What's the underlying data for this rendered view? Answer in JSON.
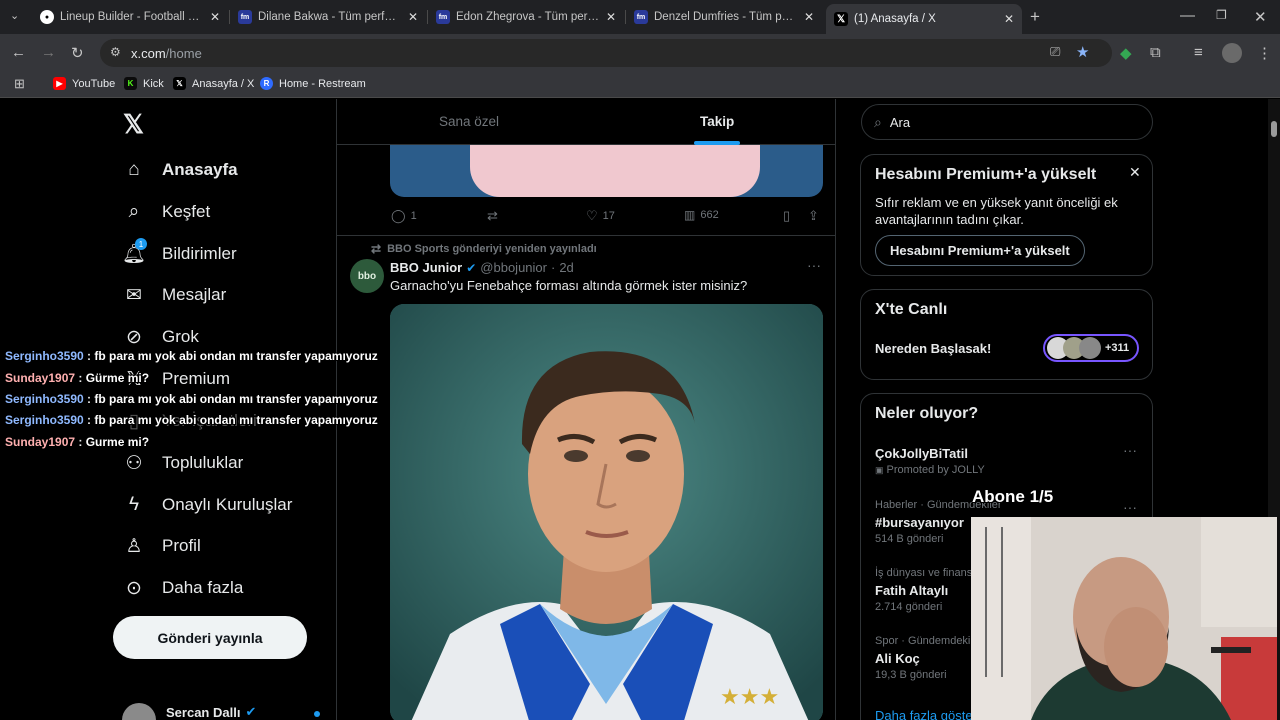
{
  "tabs": [
    {
      "title": "Lineup Builder - Football Forma",
      "icon": "soccer-ball-icon"
    },
    {
      "title": "Dilane Bakwa - Tüm performan",
      "icon": "fm-icon"
    },
    {
      "title": "Edon Zhegrova - Tüm performa",
      "icon": "fm-icon"
    },
    {
      "title": "Denzel Dumfries - Tüm perform",
      "icon": "fm-icon"
    },
    {
      "title": "(1) Anasayfa / X",
      "icon": "x-logo-icon"
    }
  ],
  "address": {
    "host": "x.com",
    "path": "/home"
  },
  "bookmarks": [
    {
      "label": "YouTube",
      "color": "#ff0000"
    },
    {
      "label": "Kick",
      "color": "#53fc18"
    },
    {
      "label": "Anasayfa / X",
      "color": "#000000"
    },
    {
      "label": "Home - Restream",
      "color": "#2f6bff"
    }
  ],
  "nav": {
    "items": [
      {
        "label": "Anasayfa",
        "icon": "home-icon"
      },
      {
        "label": "Keşfet",
        "icon": "search-icon"
      },
      {
        "label": "Bildirimler",
        "icon": "bell-icon",
        "badge": "1"
      },
      {
        "label": "Mesajlar",
        "icon": "mail-icon"
      },
      {
        "label": "Grok",
        "icon": "grok-icon"
      },
      {
        "label": "Premium",
        "icon": "x-icon"
      },
      {
        "label": "Yer İşaretleri",
        "icon": "bookmark-icon"
      },
      {
        "label": "Topluluklar",
        "icon": "people-icon"
      },
      {
        "label": "Onaylı Kuruluşlar",
        "icon": "lightning-icon"
      },
      {
        "label": "Profil",
        "icon": "person-icon"
      },
      {
        "label": "Daha fazla",
        "icon": "more-icon"
      }
    ],
    "post_button": "Gönderi yayınla",
    "account_name": "Sercan Dallı"
  },
  "feed": {
    "tabs": [
      "Sana özel",
      "Takip"
    ],
    "active_tab": "Takip",
    "prev_tweet_stats": {
      "replies": "1",
      "likes": "17",
      "views": "662"
    },
    "repost_label": "BBO Sports gönderiyi yeniden yayınladı",
    "tweet": {
      "author": "BBO Junior",
      "handle": "@bbojunior",
      "age": "2d",
      "text": "Garnacho'yu Fenebahçe forması altında görmek ister misiniz?",
      "avatar_text": "bbo"
    }
  },
  "search": {
    "placeholder": "Ara"
  },
  "premium_card": {
    "title": "Hesabını Premium+'a yükselt",
    "body": "Sıfır reklam ve en yüksek yanıt önceliği ek avantajlarının tadını çıkar.",
    "button": "Hesabını Premium+'a yükselt"
  },
  "live_card": {
    "title": "X'te Canlı",
    "subtitle": "Nereden Başlasak!",
    "count": "+311"
  },
  "trends": {
    "title": "Neler oluyor?",
    "items": [
      {
        "meta": "",
        "name": "ÇokJollyBiTatil",
        "count": "Promoted by JOLLY"
      },
      {
        "meta": "Haberler · Gündemdekiler",
        "name": "#bursayanıyor",
        "count": "514 B gönderi"
      },
      {
        "meta": "İş dünyası ve finans",
        "name": "Fatih Altaylı",
        "count": "2.714 gönderi"
      },
      {
        "meta": "Spor · Gündemdekiler",
        "name": "Ali Koç",
        "count": "19,3 B gönderi"
      }
    ],
    "show_more": "Daha fazla göster"
  },
  "chat_overlay": [
    {
      "user": "Serginho3590",
      "message": "fb para mı yok abi ondan mı transfer yapamıyoruz",
      "color": "#8fb9ff"
    },
    {
      "user": "Sunday1907",
      "message": "Gürme mi?",
      "color": "#ffb0b0"
    },
    {
      "user": "Serginho3590",
      "message": "fb para mı yok abi ondan mı transfer yapamıyoruz",
      "color": "#8fb9ff"
    },
    {
      "user": "Serginho3590",
      "message": "fb para mı yok abi ondan mı transfer yapamıyoruz",
      "color": "#8fb9ff"
    },
    {
      "user": "Sunday1907",
      "message": "Gurme mi?",
      "color": "#ffb0b0"
    }
  ],
  "stream_overlay": {
    "subscriber_goal": "Abone 1/5"
  }
}
